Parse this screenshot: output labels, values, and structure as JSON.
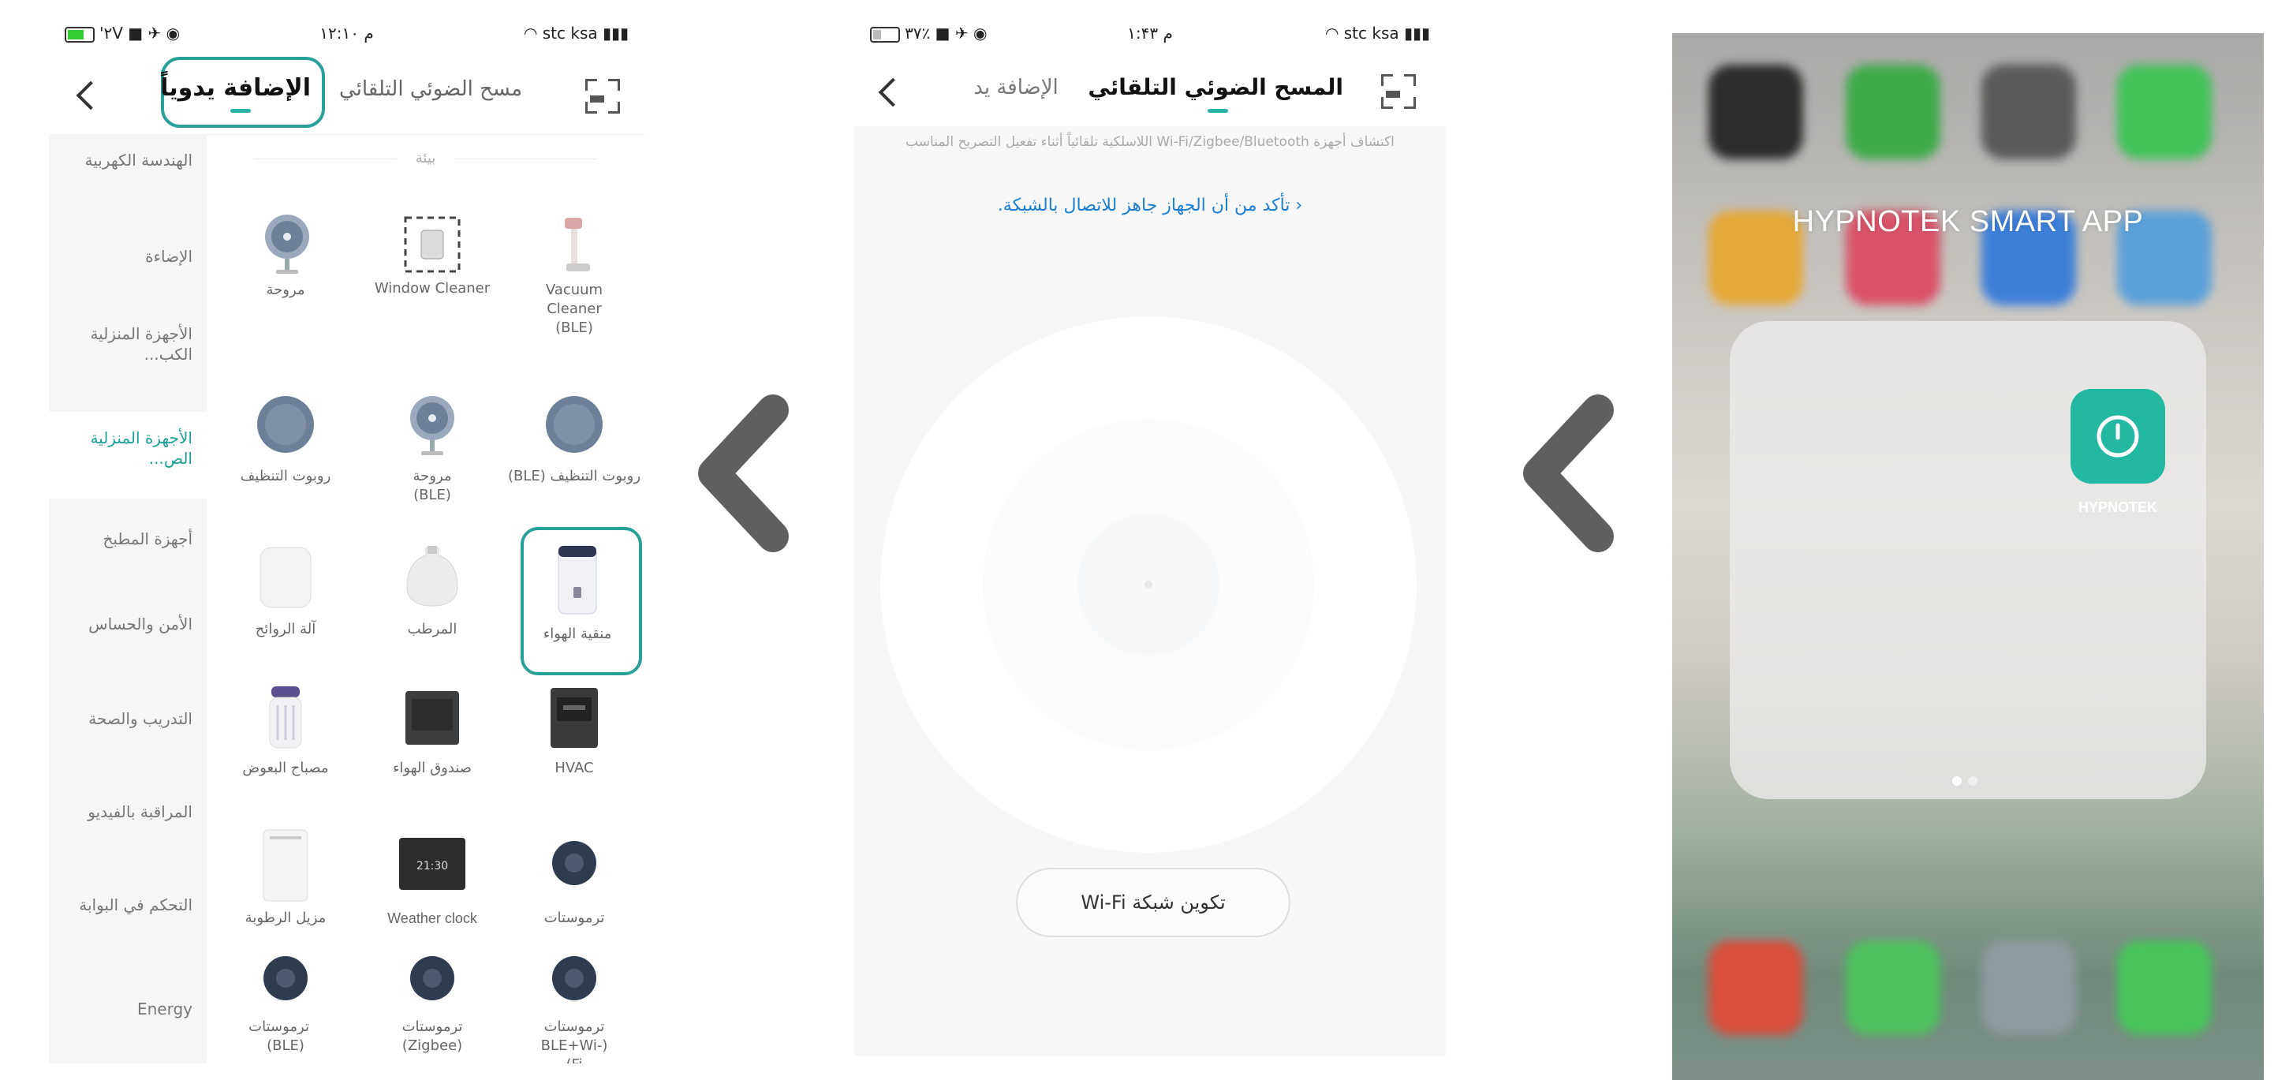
{
  "phone1": {
    "status": {
      "left": "'۲V",
      "time": "م ۱۲:۱۰",
      "carrier": "stc ksa"
    },
    "tabs": {
      "manual": "الإضافة يدوياً",
      "auto": "مسح الضوئي التلقائي"
    },
    "section_title": "بيئة",
    "sidebar": [
      "الهندسة الكهربية",
      "الإضاءة",
      "الأجهزة المنزلية الكب...",
      "الأجهزة المنزلية الص...",
      "أجهزة المطبخ",
      "الأمن والحساس",
      "التدريب والصحة",
      "المراقبة بالفيديو",
      "التحكم في البوابة",
      "Energy"
    ],
    "devices": [
      "مروحة",
      "Window Cleaner",
      "Vacuum Cleaner (BLE)",
      "روبوت التنظيف",
      "مروحة (BLE)",
      "روبوت التنظيف (BLE)",
      "آلة الروائح",
      "المرطب",
      "منقية الهواء",
      "مصباح البعوض",
      "صندوق الهواء",
      "HVAC",
      "مزيل الرطوبة",
      "Weather clock",
      "ترموستات",
      "ترموستات (BLE)",
      "ترموستات (Zigbee)",
      "ترموستات (BLE+Wi-Fi)"
    ],
    "clock_text": "21:30"
  },
  "phone2": {
    "status": {
      "left": "۳۷٪",
      "time": "م ۱:۴۳",
      "carrier": "stc ksa"
    },
    "tabs": {
      "auto": "المسح الضوئي التلقائي",
      "manual": "الإضافة يد"
    },
    "instruction": "اكتشاف أجهزة Wi-Fi/Zigbee/Bluetooth اللاسلكية تلقائياً أثناء تفعيل التصريح المناسب",
    "link": "‹ تأكد من أن الجهاز جاهز للاتصال بالشبكة.",
    "wifi_button": "تكوين شبكة Wi-Fi"
  },
  "phone3": {
    "folder_title": "HYPNOTEK SMART APP",
    "app_label": "HYPNOTEK"
  },
  "colors": {
    "accent": "#2aa198",
    "link": "#1a7fd4",
    "app": "#22b8a2",
    "chevron": "#5f5f5f"
  }
}
